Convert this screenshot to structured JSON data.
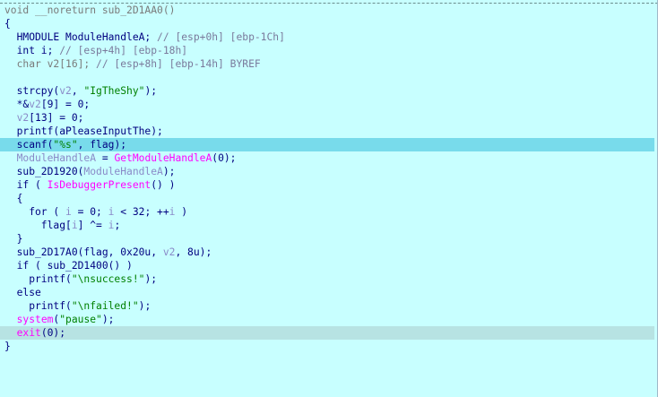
{
  "editor": {
    "lines": [
      {
        "highlight": "",
        "tokens": [
          {
            "t": "void __noreturn sub_2D1AA0()",
            "c": "c-gray"
          }
        ]
      },
      {
        "highlight": "",
        "tokens": [
          {
            "t": "{",
            "c": "c-plain"
          }
        ]
      },
      {
        "highlight": "",
        "tokens": [
          {
            "t": "  HMODULE ModuleHandleA; ",
            "c": "c-plain"
          },
          {
            "t": "// [esp+0h] [ebp-1Ch]",
            "c": "c-comment"
          }
        ]
      },
      {
        "highlight": "",
        "tokens": [
          {
            "t": "  int i; ",
            "c": "c-plain"
          },
          {
            "t": "// [esp+4h] [ebp-18h]",
            "c": "c-comment"
          }
        ]
      },
      {
        "highlight": "",
        "tokens": [
          {
            "t": "  char v2[16]; ",
            "c": "c-gray"
          },
          {
            "t": "// [esp+8h] [ebp-14h] BYREF",
            "c": "c-comment"
          }
        ]
      },
      {
        "highlight": "",
        "tokens": [
          {
            "t": "",
            "c": "c-plain"
          }
        ]
      },
      {
        "highlight": "",
        "tokens": [
          {
            "t": "  strcpy(",
            "c": "c-plain"
          },
          {
            "t": "v2",
            "c": "c-var"
          },
          {
            "t": ", ",
            "c": "c-plain"
          },
          {
            "t": "\"IgTheShy\"",
            "c": "c-str"
          },
          {
            "t": ");",
            "c": "c-plain"
          }
        ]
      },
      {
        "highlight": "",
        "tokens": [
          {
            "t": "  *&",
            "c": "c-plain"
          },
          {
            "t": "v2",
            "c": "c-var"
          },
          {
            "t": "[9] = 0;",
            "c": "c-plain"
          }
        ]
      },
      {
        "highlight": "",
        "tokens": [
          {
            "t": "  ",
            "c": "c-plain"
          },
          {
            "t": "v2",
            "c": "c-var"
          },
          {
            "t": "[13] = 0;",
            "c": "c-plain"
          }
        ]
      },
      {
        "highlight": "",
        "tokens": [
          {
            "t": "  printf(aPleaseInputThe);",
            "c": "c-plain"
          }
        ]
      },
      {
        "highlight": "hl-current",
        "tokens": [
          {
            "t": "  scanf(",
            "c": "c-plain"
          },
          {
            "t": "\"%s\"",
            "c": "c-str"
          },
          {
            "t": ", flag);",
            "c": "c-plain"
          }
        ]
      },
      {
        "highlight": "",
        "tokens": [
          {
            "t": "  ",
            "c": "c-plain"
          },
          {
            "t": "ModuleHandleA",
            "c": "c-var"
          },
          {
            "t": " = ",
            "c": "c-plain"
          },
          {
            "t": "GetModuleHandleA",
            "c": "c-imp"
          },
          {
            "t": "(0);",
            "c": "c-plain"
          }
        ]
      },
      {
        "highlight": "",
        "tokens": [
          {
            "t": "  sub_2D1920(",
            "c": "c-plain"
          },
          {
            "t": "ModuleHandleA",
            "c": "c-var"
          },
          {
            "t": ");",
            "c": "c-plain"
          }
        ]
      },
      {
        "highlight": "",
        "tokens": [
          {
            "t": "  if ( ",
            "c": "c-plain"
          },
          {
            "t": "IsDebuggerPresent",
            "c": "c-imp"
          },
          {
            "t": "() )",
            "c": "c-plain"
          }
        ]
      },
      {
        "highlight": "",
        "tokens": [
          {
            "t": "  {",
            "c": "c-plain"
          }
        ]
      },
      {
        "highlight": "",
        "tokens": [
          {
            "t": "    for ( ",
            "c": "c-plain"
          },
          {
            "t": "i",
            "c": "c-var"
          },
          {
            "t": " = 0; ",
            "c": "c-plain"
          },
          {
            "t": "i",
            "c": "c-var"
          },
          {
            "t": " < 32; ++",
            "c": "c-plain"
          },
          {
            "t": "i",
            "c": "c-var"
          },
          {
            "t": " )",
            "c": "c-plain"
          }
        ]
      },
      {
        "highlight": "",
        "tokens": [
          {
            "t": "      flag[",
            "c": "c-plain"
          },
          {
            "t": "i",
            "c": "c-var"
          },
          {
            "t": "] ^= ",
            "c": "c-plain"
          },
          {
            "t": "i",
            "c": "c-var"
          },
          {
            "t": ";",
            "c": "c-plain"
          }
        ]
      },
      {
        "highlight": "",
        "tokens": [
          {
            "t": "  }",
            "c": "c-plain"
          }
        ]
      },
      {
        "highlight": "",
        "tokens": [
          {
            "t": "  sub_2D17A0(flag, 0x20u, ",
            "c": "c-plain"
          },
          {
            "t": "v2",
            "c": "c-var"
          },
          {
            "t": ", 8u);",
            "c": "c-plain"
          }
        ]
      },
      {
        "highlight": "",
        "tokens": [
          {
            "t": "  if ( sub_2D1400() )",
            "c": "c-plain"
          }
        ]
      },
      {
        "highlight": "",
        "tokens": [
          {
            "t": "    printf(",
            "c": "c-plain"
          },
          {
            "t": "\"\\nsuccess!\"",
            "c": "c-str"
          },
          {
            "t": ");",
            "c": "c-plain"
          }
        ]
      },
      {
        "highlight": "",
        "tokens": [
          {
            "t": "  else",
            "c": "c-plain"
          }
        ]
      },
      {
        "highlight": "",
        "tokens": [
          {
            "t": "    printf(",
            "c": "c-plain"
          },
          {
            "t": "\"\\nfailed!\"",
            "c": "c-str"
          },
          {
            "t": ");",
            "c": "c-plain"
          }
        ]
      },
      {
        "highlight": "",
        "tokens": [
          {
            "t": "  ",
            "c": "c-plain"
          },
          {
            "t": "system",
            "c": "c-imp"
          },
          {
            "t": "(",
            "c": "c-plain"
          },
          {
            "t": "\"pause\"",
            "c": "c-str"
          },
          {
            "t": ");",
            "c": "c-plain"
          }
        ]
      },
      {
        "highlight": "hl-last",
        "tokens": [
          {
            "t": "  ",
            "c": "c-plain"
          },
          {
            "t": "exit",
            "c": "c-imp"
          },
          {
            "t": "(0);",
            "c": "c-plain"
          }
        ]
      },
      {
        "highlight": "",
        "tokens": [
          {
            "t": "}",
            "c": "c-plain"
          }
        ]
      }
    ]
  }
}
